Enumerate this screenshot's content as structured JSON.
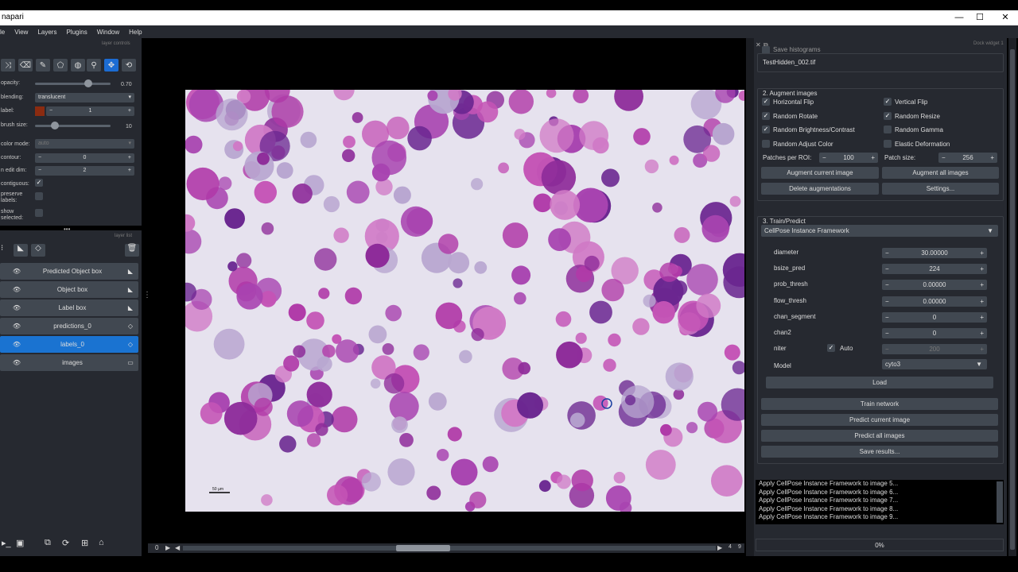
{
  "window": {
    "title": "napari",
    "minimize": "—",
    "maximize": "☐",
    "close": "✕"
  },
  "menu": [
    "le",
    "View",
    "Layers",
    "Plugins",
    "Window",
    "Help"
  ],
  "layer_controls": {
    "header": "layer controls",
    "opacity_label": "opacity:",
    "opacity_value": "0.70",
    "opacity_level": 0.7,
    "blending_label": "blending:",
    "blending_value": "translucent",
    "label_label": "label:",
    "label_value": "1",
    "label_color": "#8b2b10",
    "brush_label": "brush size:",
    "brush_value": "10",
    "colormode_label": "color mode:",
    "colormode_value": "auto",
    "contour_label": "contour:",
    "contour_value": "0",
    "ndim_label": "n edit dim:",
    "ndim_value": "2",
    "contiguous_label": "contiguous:",
    "preserve_label": "preserve\nlabels:",
    "show_label": "show\nselected:"
  },
  "layer_list": {
    "header": "layer list",
    "layers": [
      {
        "name": "Predicted Object box",
        "type": "shapes"
      },
      {
        "name": "Object box",
        "type": "shapes"
      },
      {
        "name": "Label box",
        "type": "shapes"
      },
      {
        "name": "predictions_0",
        "type": "labels"
      },
      {
        "name": "labels_0",
        "type": "labels",
        "selected": true
      },
      {
        "name": "images",
        "type": "image"
      }
    ]
  },
  "canvas": {
    "scale_bar": "50 µm"
  },
  "dims": {
    "left": "0",
    "right_a": "4",
    "right_b": "9"
  },
  "right": {
    "dock_header": "Dock widget 1",
    "save_histograms": "Save histograms",
    "file": "TestHidden_002.tif",
    "augment": {
      "title": "2. Augment images",
      "options": [
        {
          "label": "Horizontal Flip",
          "checked": true
        },
        {
          "label": "Vertical Flip",
          "checked": true
        },
        {
          "label": "Random Rotate",
          "checked": true
        },
        {
          "label": "Random Resize",
          "checked": true
        },
        {
          "label": "Random Brightness/Contrast",
          "checked": true
        },
        {
          "label": "Random Gamma",
          "checked": false
        },
        {
          "label": "Random Adjust Color",
          "checked": false
        },
        {
          "label": "Elastic Deformation",
          "checked": false
        }
      ],
      "patches_label": "Patches per ROI:",
      "patches_value": "100",
      "patch_size_label": "Patch size:",
      "patch_size_value": "256",
      "btn_augment_current": "Augment current image",
      "btn_augment_all": "Augment all images",
      "btn_delete": "Delete augmentations",
      "btn_settings": "Settings..."
    },
    "train": {
      "title": "3. Train/Predict",
      "framework": "CellPose Instance Framework",
      "params": [
        {
          "name": "diameter",
          "value": "30.00000"
        },
        {
          "name": "bsize_pred",
          "value": "224"
        },
        {
          "name": "prob_thresh",
          "value": "0.00000"
        },
        {
          "name": "flow_thresh",
          "value": "0.00000"
        },
        {
          "name": "chan_segment",
          "value": "0"
        },
        {
          "name": "chan2",
          "value": "0"
        },
        {
          "name": "niter",
          "value": "200"
        }
      ],
      "auto_label": "Auto",
      "model_label": "Model",
      "model_value": "cyto3",
      "btn_load": "Load",
      "btn_train": "Train network",
      "btn_predict_current": "Predict current image",
      "btn_predict_all": "Predict all images",
      "btn_save": "Save results..."
    },
    "log": [
      "Apply CellPose Instance Framework to image 5...",
      "Apply CellPose Instance Framework to image 6...",
      "Apply CellPose Instance Framework to image 7...",
      "Apply CellPose Instance Framework to image 8...",
      "Apply CellPose Instance Framework to image 9..."
    ],
    "progress": "0%"
  }
}
